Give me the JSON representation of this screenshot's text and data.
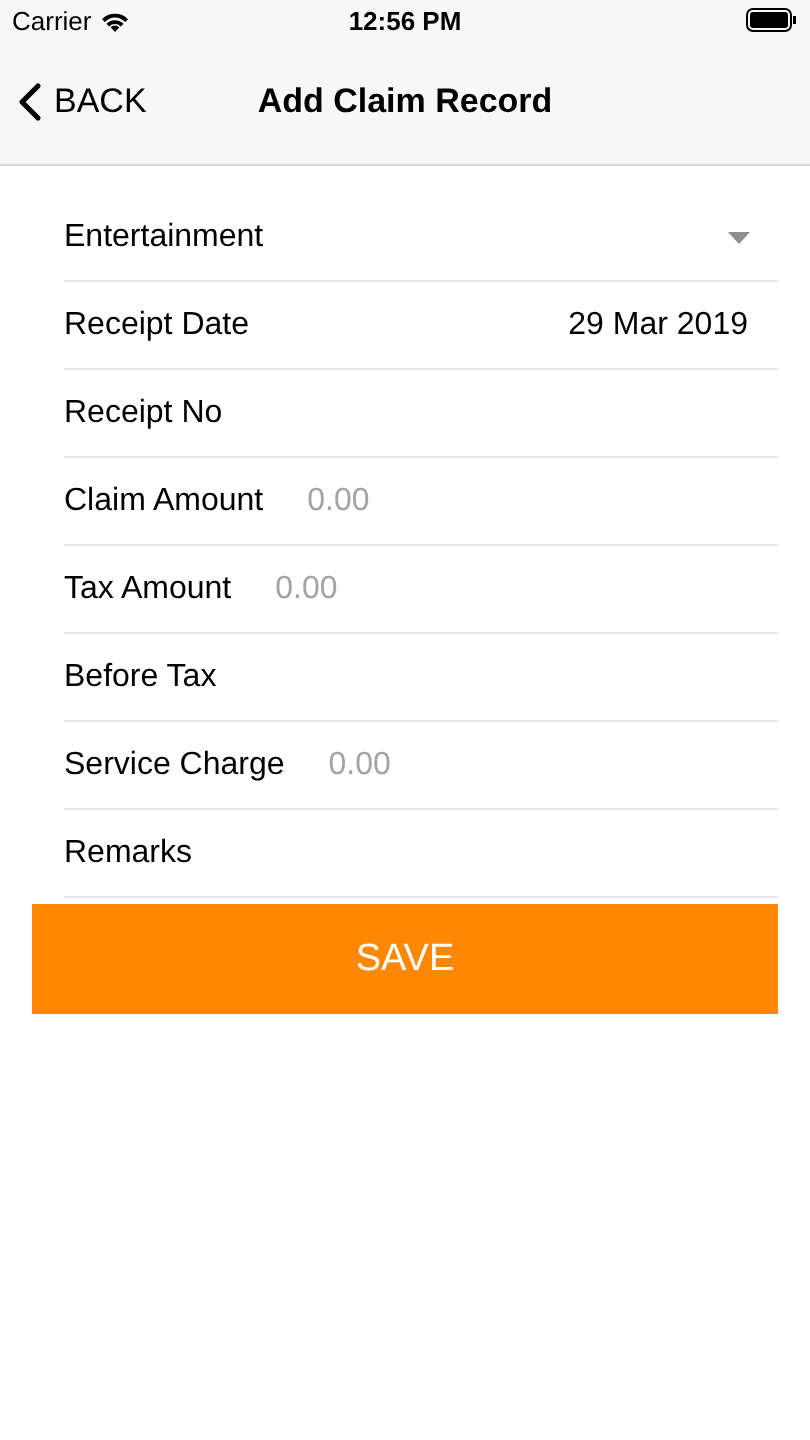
{
  "status_bar": {
    "carrier": "Carrier",
    "time": "12:56 PM"
  },
  "nav": {
    "back": "BACK",
    "title": "Add Claim Record"
  },
  "fields": [
    {
      "kind": "dropdown",
      "value": "Entertainment"
    },
    {
      "kind": "value",
      "label": "Receipt Date",
      "value": "29 Mar 2019"
    },
    {
      "kind": "input",
      "label": "Receipt No"
    },
    {
      "kind": "input",
      "label": "Claim Amount",
      "placeholder": "0.00"
    },
    {
      "kind": "input",
      "label": "Tax Amount",
      "placeholder": "0.00"
    },
    {
      "kind": "input",
      "label": "Before Tax"
    },
    {
      "kind": "input",
      "label": "Service Charge",
      "placeholder": "0.00"
    },
    {
      "kind": "input",
      "label": "Remarks"
    }
  ],
  "save_button": "SAVE"
}
